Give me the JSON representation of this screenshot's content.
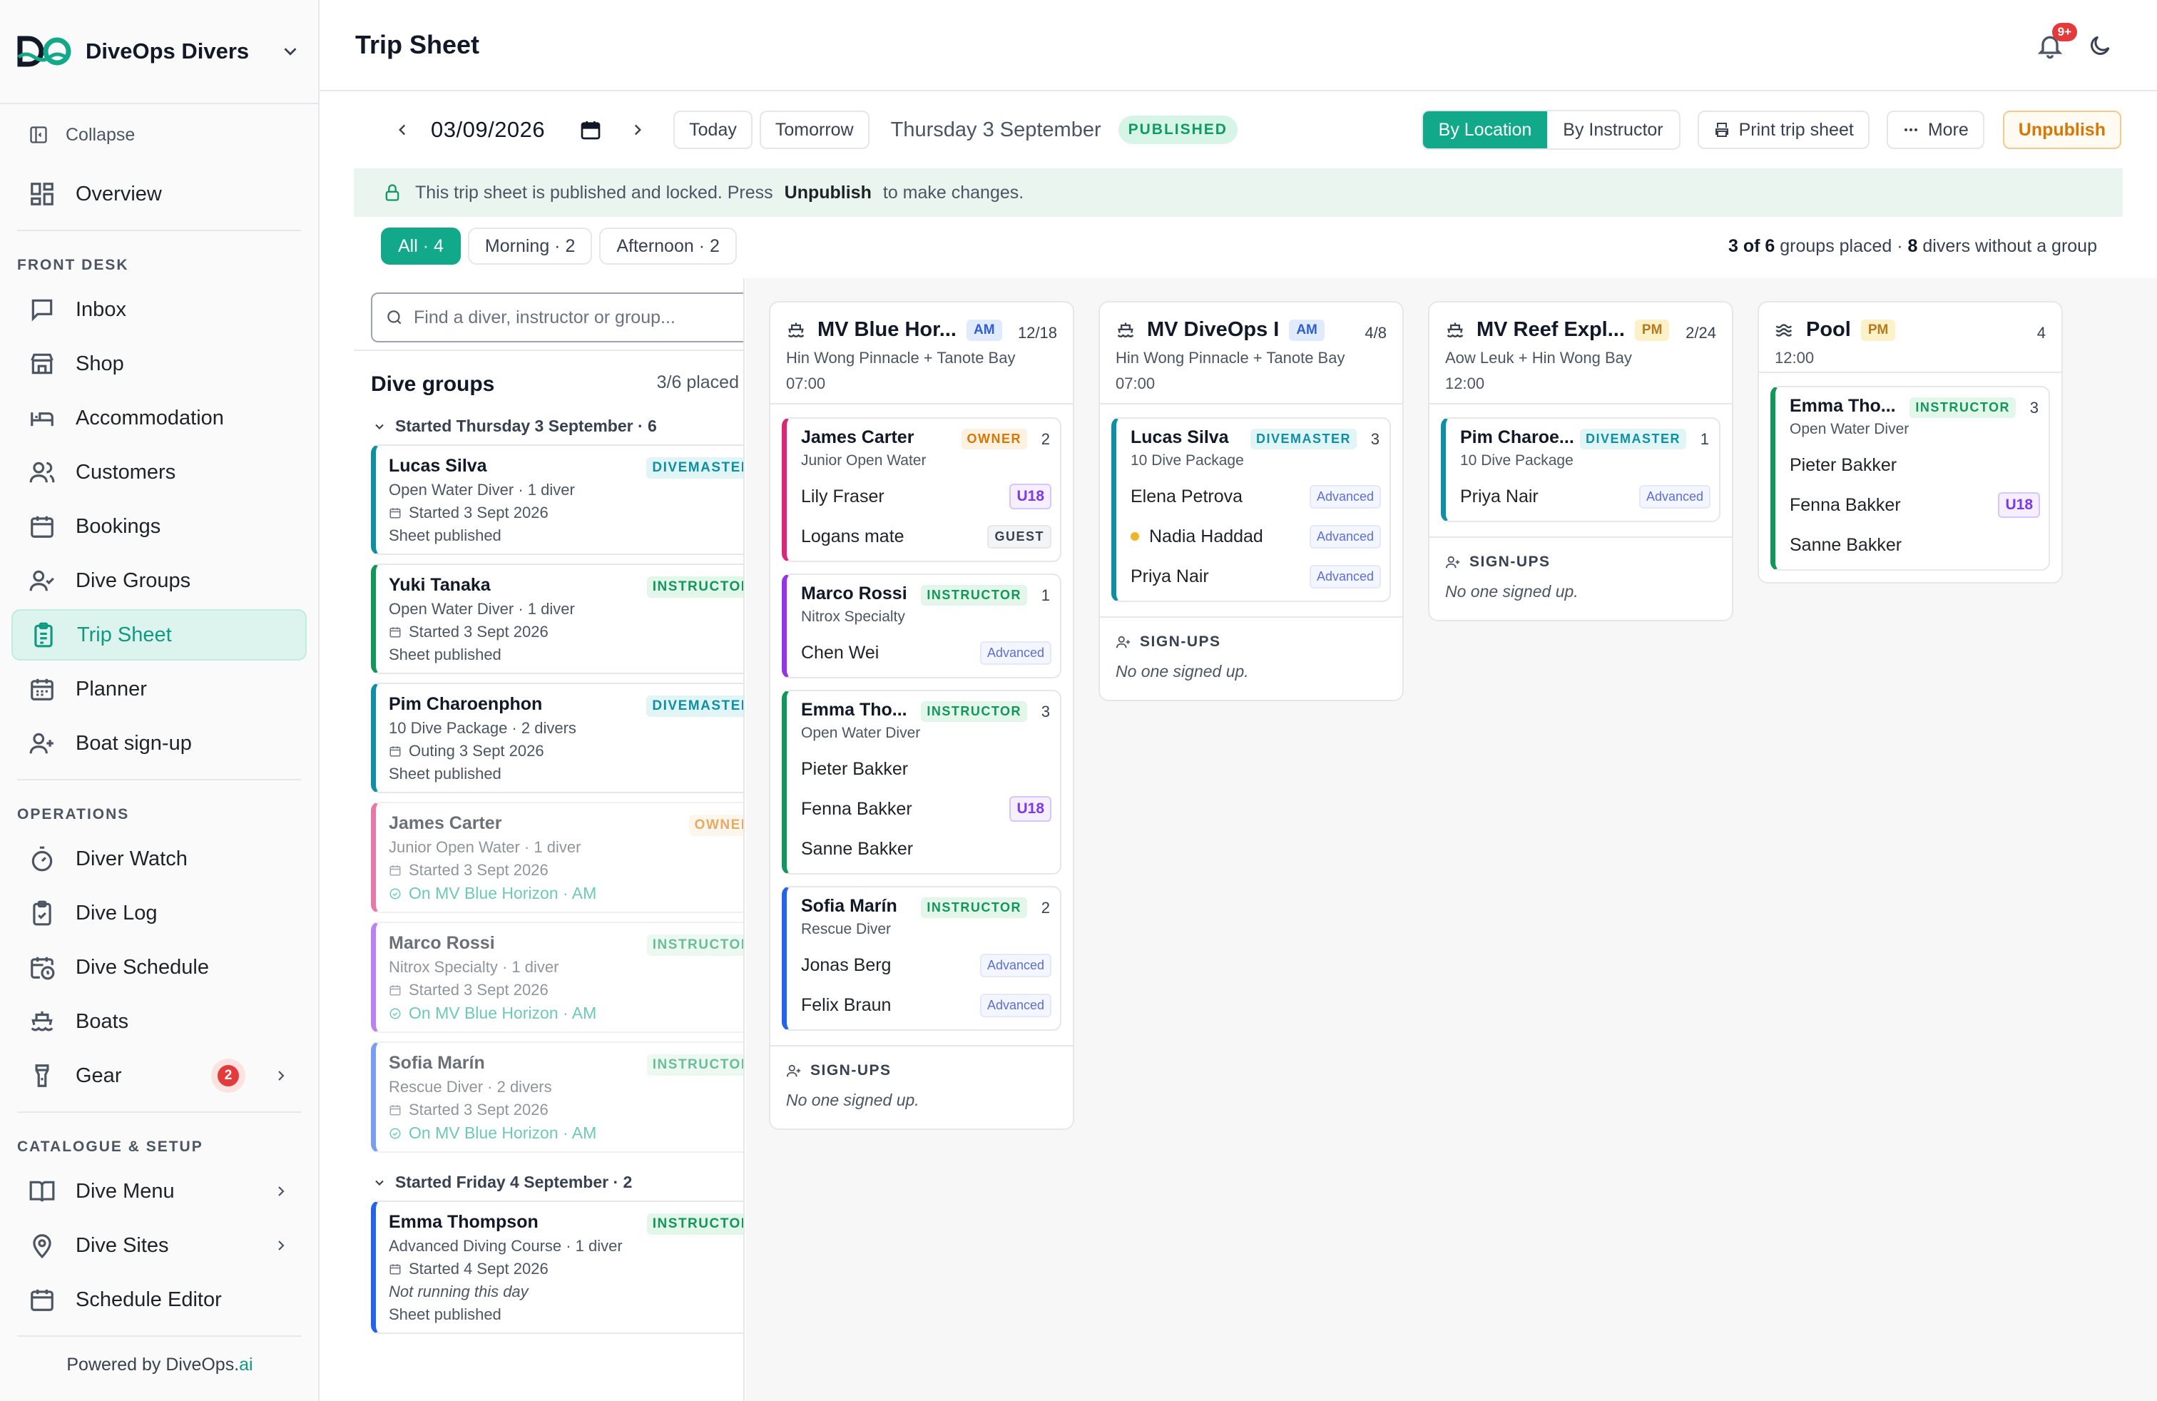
{
  "brand": {
    "name": "DiveOps Divers"
  },
  "sidebar": {
    "collapse_label": "Collapse",
    "overview": "Overview",
    "sections": {
      "front_desk": "FRONT DESK",
      "operations": "OPERATIONS",
      "catalogue": "CATALOGUE & SETUP"
    },
    "front_desk_items": [
      {
        "label": "Inbox",
        "icon": "inbox-icon"
      },
      {
        "label": "Shop",
        "icon": "shop-icon"
      },
      {
        "label": "Accommodation",
        "icon": "bed-icon"
      },
      {
        "label": "Customers",
        "icon": "users-icon"
      },
      {
        "label": "Bookings",
        "icon": "calendar-icon"
      },
      {
        "label": "Dive Groups",
        "icon": "user-check-icon"
      },
      {
        "label": "Trip Sheet",
        "icon": "clipboard-icon",
        "active": true
      },
      {
        "label": "Planner",
        "icon": "calendar-icon"
      },
      {
        "label": "Boat sign-up",
        "icon": "user-plus-icon"
      }
    ],
    "operations_items": [
      {
        "label": "Diver Watch",
        "icon": "stopwatch-icon"
      },
      {
        "label": "Dive Log",
        "icon": "clipboard-check-icon"
      },
      {
        "label": "Dive Schedule",
        "icon": "calendar-clock-icon"
      },
      {
        "label": "Boats",
        "icon": "ship-icon"
      },
      {
        "label": "Gear",
        "icon": "flashlight-icon",
        "badge": "2"
      }
    ],
    "catalogue_items": [
      {
        "label": "Dive Menu",
        "icon": "book-icon"
      },
      {
        "label": "Dive Sites",
        "icon": "map-pin-icon"
      },
      {
        "label": "Schedule Editor",
        "icon": "calendar-icon"
      }
    ],
    "powered_prefix": "Powered by DiveOps.",
    "powered_suffix": "ai"
  },
  "header": {
    "title": "Trip Sheet",
    "notification_badge": "9+"
  },
  "toolbar": {
    "date_value": "03/09/2026",
    "today": "Today",
    "tomorrow": "Tomorrow",
    "date_long": "Thursday 3 September",
    "status": "PUBLISHED",
    "by_location": "By Location",
    "by_instructor": "By Instructor",
    "print": "Print trip sheet",
    "more": "More",
    "unpublish": "Unpublish"
  },
  "banner": {
    "pre": "This trip sheet is published and locked. Press",
    "action": "Unpublish",
    "post": "to make changes."
  },
  "filters": {
    "all": "All · 4",
    "morning": "Morning · 2",
    "afternoon": "Afternoon · 2",
    "stats_placed": "3 of 6",
    "stats_placed_suffix": "groups placed ·",
    "stats_unassigned": "8",
    "stats_unassigned_suffix": "divers without a group"
  },
  "groups_panel": {
    "search_placeholder": "Find a diver, instructor or group...",
    "title": "Dive groups",
    "count": "3/6 placed",
    "section1": "Started Thursday 3 September · 6",
    "section2": "Started Friday 4 September · 2",
    "cards": [
      {
        "name": "Lucas Silva",
        "role": "DIVEMASTER",
        "line1": "Open Water Diver · 1 diver",
        "line2": "Started 3 Sept 2026",
        "line3": "Sheet published"
      },
      {
        "name": "Yuki Tanaka",
        "role": "INSTRUCTOR",
        "line1": "Open Water Diver · 1 diver",
        "line2": "Started 3 Sept 2026",
        "line3": "Sheet published"
      },
      {
        "name": "Pim Charoenphon",
        "role": "DIVEMASTER",
        "line1": "10 Dive Package · 2 divers",
        "line2": "Outing 3 Sept 2026",
        "line3": "Sheet published"
      },
      {
        "name": "James Carter",
        "role": "OWNER",
        "line1": "Junior Open Water · 1 diver",
        "line2": "Started 3 Sept 2026",
        "line3": "On MV Blue Horizon · AM"
      },
      {
        "name": "Marco Rossi",
        "role": "INSTRUCTOR",
        "line1": "Nitrox Specialty · 1 diver",
        "line2": "Started 3 Sept 2026",
        "line3": "On MV Blue Horizon · AM"
      },
      {
        "name": "Sofia Marín",
        "role": "INSTRUCTOR",
        "line1": "Rescue Diver · 2 divers",
        "line2": "Started 3 Sept 2026",
        "line3": "On MV Blue Horizon · AM"
      },
      {
        "name": "Emma Thompson",
        "role": "INSTRUCTOR",
        "line1": "Advanced Diving Course · 1 diver",
        "line2": "Started 4 Sept 2026",
        "line3": "Not running this day",
        "line4": "Sheet published"
      }
    ]
  },
  "board": {
    "signups_label": "SIGN-UPS",
    "signups_empty": "No one signed up.",
    "columns": [
      {
        "name": "MV Blue Hor...",
        "slot": "AM",
        "capacity": "12/18",
        "route": "Hin Wong Pinnacle + Tanote Bay",
        "time": "07:00",
        "groups": [
          {
            "leader": "James Carter",
            "role": "OWNER",
            "count": "2",
            "course": "Junior Open Water",
            "divers": [
              {
                "name": "Lily Fraser",
                "tag": "U18"
              },
              {
                "name": "Logans mate",
                "tag": "GUEST"
              }
            ]
          },
          {
            "leader": "Marco Rossi",
            "role": "INSTRUCTOR",
            "count": "1",
            "course": "Nitrox Specialty",
            "divers": [
              {
                "name": "Chen Wei",
                "tag": "Advanced"
              }
            ]
          },
          {
            "leader": "Emma Tho...",
            "role": "INSTRUCTOR",
            "count": "3",
            "course": "Open Water Diver",
            "divers": [
              {
                "name": "Pieter Bakker",
                "tag": ""
              },
              {
                "name": "Fenna Bakker",
                "tag": "U18"
              },
              {
                "name": "Sanne Bakker",
                "tag": ""
              }
            ]
          },
          {
            "leader": "Sofia Marín",
            "role": "INSTRUCTOR",
            "count": "2",
            "course": "Rescue Diver",
            "divers": [
              {
                "name": "Jonas Berg",
                "tag": "Advanced"
              },
              {
                "name": "Felix Braun",
                "tag": "Advanced"
              }
            ]
          }
        ]
      },
      {
        "name": "MV DiveOps I",
        "slot": "AM",
        "capacity": "4/8",
        "route": "Hin Wong Pinnacle + Tanote Bay",
        "time": "07:00",
        "groups": [
          {
            "leader": "Lucas Silva",
            "role": "DIVEMASTER",
            "count": "3",
            "course": "10 Dive Package",
            "divers": [
              {
                "name": "Elena Petrova",
                "tag": "Advanced"
              },
              {
                "name": "Nadia Haddad",
                "tag": "Advanced"
              },
              {
                "name": "Priya Nair",
                "tag": "Advanced"
              }
            ]
          }
        ]
      },
      {
        "name": "MV Reef Expl...",
        "slot": "PM",
        "capacity": "2/24",
        "route": "Aow Leuk + Hin Wong Bay",
        "time": "12:00",
        "groups": [
          {
            "leader": "Pim Charoe...",
            "role": "DIVEMASTER",
            "count": "1",
            "course": "10 Dive Package",
            "divers": [
              {
                "name": "Priya Nair",
                "tag": "Advanced"
              }
            ]
          }
        ]
      },
      {
        "name": "Pool",
        "slot": "PM",
        "capacity": "4",
        "route": "",
        "time": "12:00",
        "groups": [
          {
            "leader": "Emma Tho...",
            "role": "INSTRUCTOR",
            "count": "3",
            "course": "Open Water Diver",
            "divers": [
              {
                "name": "Pieter Bakker",
                "tag": ""
              },
              {
                "name": "Fenna Bakker",
                "tag": "U18"
              },
              {
                "name": "Sanne Bakker",
                "tag": ""
              }
            ]
          }
        ]
      }
    ]
  }
}
